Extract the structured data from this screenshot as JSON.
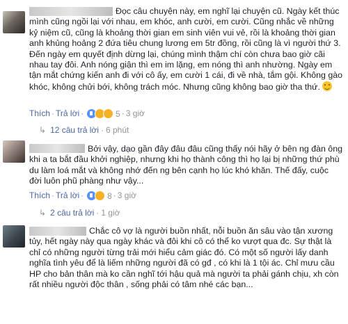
{
  "comments": [
    {
      "text": "Đọc câu chuyện này, em nghĩ lại chuyện cũ. Ngày kết thúc mình cũng ngồi lại với nhau, em khóc, anh cười, em cười. Cũng nhắc về những kỷ niệm cũ, cũng là khoảng thời gian em sinh viên vui vẻ, rồi là khoảng thời gian anh khủng hoảng 2 đứa tiêu chung lương em 5tr đồng, rồi cũng là vì người thứ 3. Đến ngày em quyết định dừng lại, chúng mình thậm chí còn chưa bao giờ cãi nhau tay đôi. Anh nóng giận thì em im lặng, em nóng thì anh nhường. Ngày em tận mắt chứng kiến anh đi với cô ấy, em cười 1 cái, đi về nhà, tắm gội. Không gào khóc, không chửi bới, không trách móc. Nhưng cũng không bao giờ tha thứ.",
      "like": "Thích",
      "reply": "Trả lời",
      "reaction_count": "5",
      "time": "3 giờ",
      "replies": "12 câu trả lời",
      "replies_time": "6 phút"
    },
    {
      "text": "Bởi vậy, dạo gần đây đâu đâu cũng thấy nói hãy ở bên ng đàn ông khi a ta bắt đầu khởi nghiệp, nhưng khi họ thành công thì họ lại bị những thứ phù du làm loá mắt và không nhớ đến ng bên cạnh họ lúc khó khăn. Thế đấy, cuộc đời luôn phũ phàng như vậy...",
      "like": "Thích",
      "reply": "Trả lời",
      "reaction_count": "8",
      "time": "3 giờ",
      "replies": "2 câu trả lời",
      "replies_time": "1 giờ"
    },
    {
      "text": "Chắc cô vợ là người buồn nhất, nỗi buồn ăn sâu vào tận xương tủy, hết ngày này qua ngày khác và đôi khi cô có thể ko vượt qua đc. Sự thật là chỉ có những người từng trải mới hiểu cảm giác đó. Có một số người lấy danh nghĩa tình yêu để là liếm những người đã có gđ , có khi là 1 tội ác. Chỉ mưu cầu HP cho bản thân mà ko cần nghĩ tới hậu quả mà người ta phải gánh chịu, xh còn rất nhiều người độc thân , sống phải có tâm nhé các bạn..."
    }
  ],
  "icons": {
    "reply_arrow": "reply-arrow-icon",
    "smile": "smile-emoji-icon",
    "reactions": [
      "like-reaction-icon",
      "haha-reaction-icon",
      "sad-reaction-icon"
    ]
  }
}
